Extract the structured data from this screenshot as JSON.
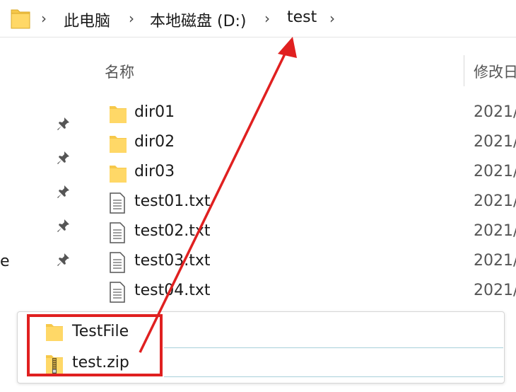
{
  "breadcrumb": {
    "items": [
      {
        "label": "此电脑"
      },
      {
        "label": "本地磁盘 (D:)"
      },
      {
        "label": "test"
      }
    ]
  },
  "sidebar": {
    "partial_label": "e",
    "pin_icon": "pin-icon"
  },
  "columns": {
    "name_label": "名称",
    "date_label": "修改日"
  },
  "files": [
    {
      "name": "dir01",
      "type": "folder",
      "date": "2021/"
    },
    {
      "name": "dir02",
      "type": "folder",
      "date": "2021/"
    },
    {
      "name": "dir03",
      "type": "folder",
      "date": "2021/"
    },
    {
      "name": "test01.txt",
      "type": "text",
      "date": "2021/"
    },
    {
      "name": "test02.txt",
      "type": "text",
      "date": "2021/"
    },
    {
      "name": "test03.txt",
      "type": "text",
      "date": "2021/"
    },
    {
      "name": "test04.txt",
      "type": "text",
      "date": "2021/"
    }
  ],
  "drop_panel": {
    "items": [
      {
        "name": "TestFile",
        "type": "folder"
      },
      {
        "name": "test.zip",
        "type": "zip"
      }
    ]
  },
  "colors": {
    "folder": "#f6c84a",
    "highlight": "#e02020",
    "arrow": "#e02020"
  }
}
